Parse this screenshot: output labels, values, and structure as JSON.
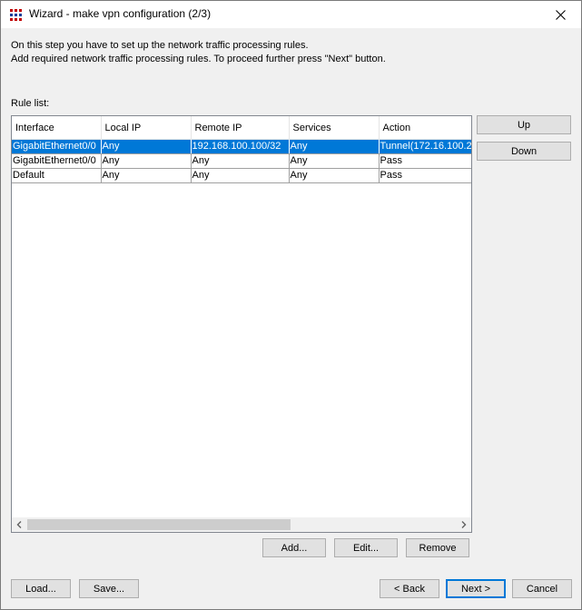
{
  "window": {
    "title": "Wizard - make vpn configuration (2/3)"
  },
  "intro": {
    "line1": "On this step you have to set up the network traffic processing rules.",
    "line2": "Add required network traffic processing rules. To proceed further press \"Next\" button."
  },
  "rule_list": {
    "label": "Rule list:",
    "columns": [
      "Interface",
      "Local IP",
      "Remote IP",
      "Services",
      "Action"
    ],
    "rows": [
      [
        "GigabitEthernet0/0",
        "Any",
        "192.168.100.100/32",
        "Any",
        "Tunnel(172.16.100.2"
      ],
      [
        "GigabitEthernet0/0",
        "Any",
        "Any",
        "Any",
        "Pass"
      ],
      [
        "Default",
        "Any",
        "Any",
        "Any",
        "Pass"
      ]
    ],
    "selected_row": 0
  },
  "side_buttons": {
    "up": "Up",
    "down": "Down"
  },
  "list_buttons": {
    "add": "Add...",
    "edit": "Edit...",
    "remove": "Remove"
  },
  "footer": {
    "load": "Load...",
    "save": "Save...",
    "back": "< Back",
    "next": "Next >",
    "cancel": "Cancel"
  },
  "icons": {
    "app": "app-icon",
    "close": "close-icon"
  }
}
